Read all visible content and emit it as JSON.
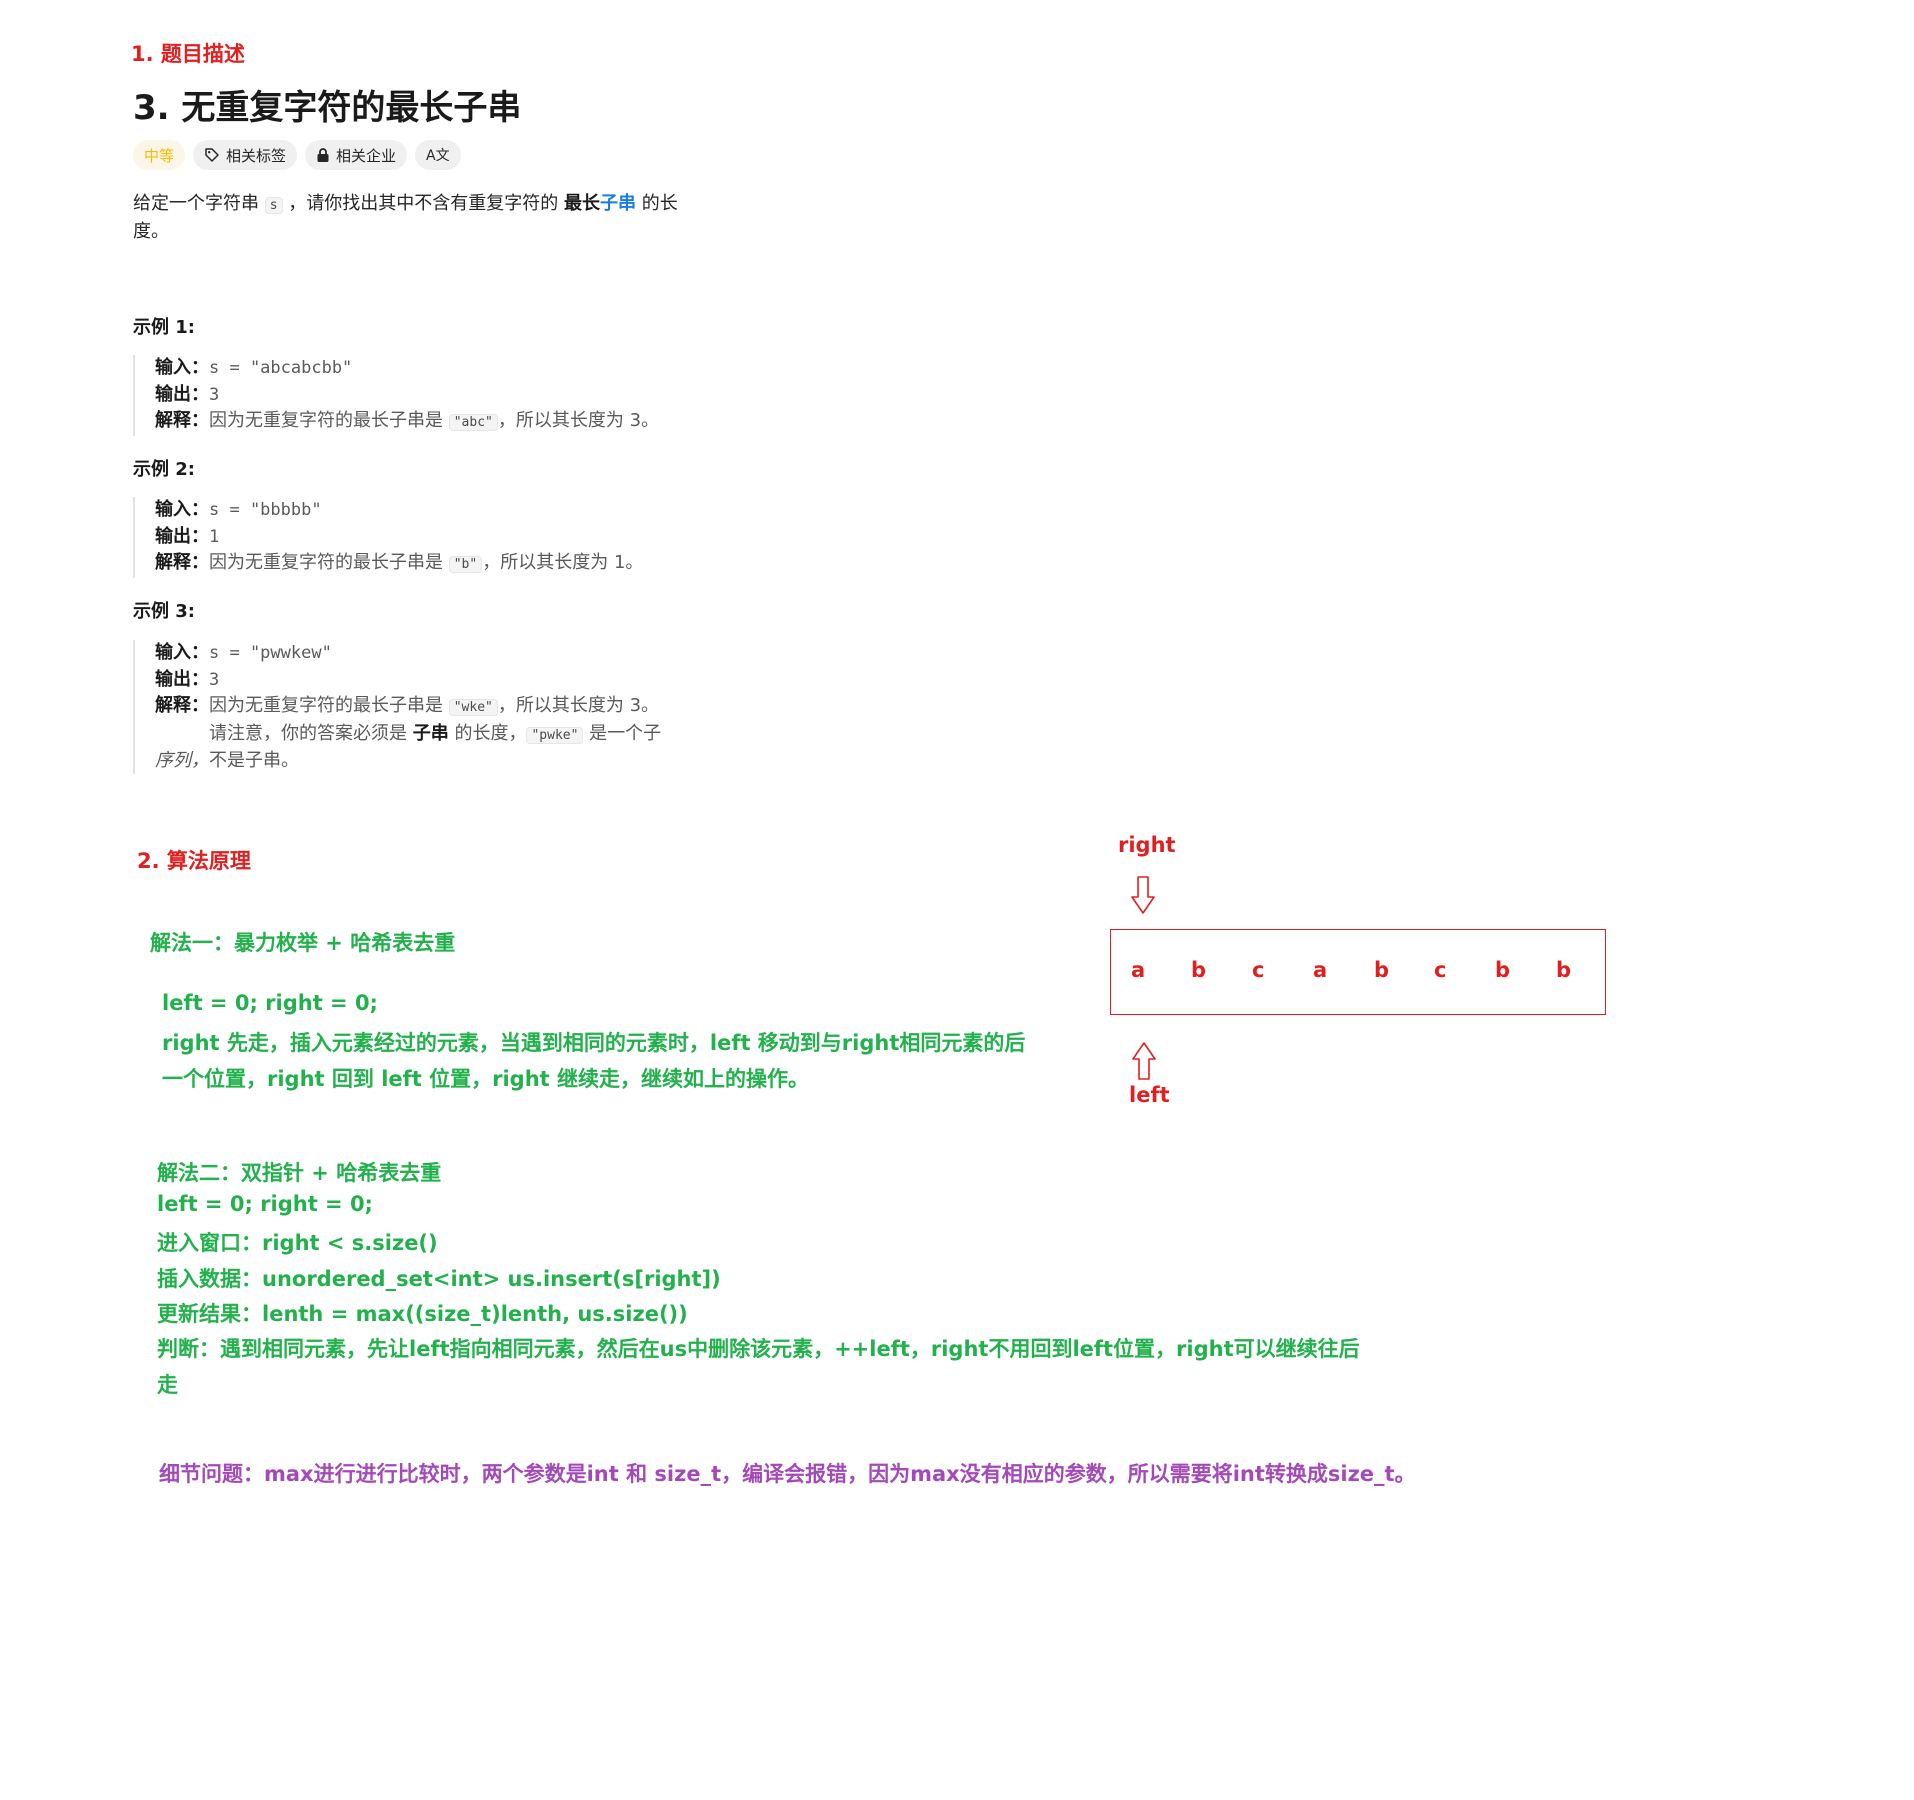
{
  "section1": {
    "title": "1. 题目描述"
  },
  "problem": {
    "title": "3. 无重复字符的最长子串",
    "tags": {
      "difficulty": "中等",
      "related_tags": "相关标签",
      "related_companies": "相关企业",
      "translate": "A文"
    },
    "description": {
      "part1": "给定一个字符串 ",
      "code": "s",
      "part2": " ，请你找出其中不含有重复字符的 ",
      "bold": "最长",
      "link": "子串",
      "part3": " 的长",
      "line2": "度。"
    }
  },
  "examples": [
    {
      "title": "示例 1:",
      "input_label": "输入：",
      "input_value": "s = \"abcabcbb\"",
      "output_label": "输出：",
      "output_value": "3",
      "explain_label": "解释：",
      "explain_text": "因为无重复字符的最长子串是 ",
      "explain_code": "\"abc\"",
      "explain_tail": "，所以其长度为 3。"
    },
    {
      "title": "示例 2:",
      "input_label": "输入：",
      "input_value": "s = \"bbbbb\"",
      "output_label": "输出：",
      "output_value": "1",
      "explain_label": "解释：",
      "explain_text": "因为无重复字符的最长子串是 ",
      "explain_code": "\"b\"",
      "explain_tail": "，所以其长度为 1。"
    },
    {
      "title": "示例 3:",
      "input_label": "输入：",
      "input_value": "s = \"pwwkew\"",
      "output_label": "输出：",
      "output_value": "3",
      "explain_label": "解释：",
      "explain_text": "因为无重复字符的最长子串是 ",
      "explain_code": "\"wke\"",
      "explain_tail": "，所以其长度为 3。",
      "note_part1": "请注意，你的答案必须是 ",
      "note_bold": "子串",
      "note_part2": " 的长度，",
      "note_code": "\"pwke\"",
      "note_part3": " 是一个子",
      "note_italic": "序列，",
      "note_part4": "不是子串。"
    }
  ],
  "section2": {
    "title": "2. 算法原理"
  },
  "method1": {
    "title": "解法一：暴力枚举 + 哈希表去重",
    "line1": "left = 0;  right = 0;",
    "line2": "right 先走，插入元素经过的元素，当遇到相同的元素时，left 移动到与right相同元素的后",
    "line3": "一个位置，right 回到 left 位置，right 继续走，继续如上的操作。"
  },
  "method2": {
    "title": "解法二：双指针  + 哈希表去重",
    "line1": "left = 0;   right = 0;",
    "line2": "进入窗口：right < s.size()",
    "line3": "插入数据：unordered_set<int> us.insert(s[right])",
    "line4": "更新结果：lenth = max((size_t)lenth, us.size())",
    "line5": "判断：遇到相同元素，先让left指向相同元素，然后在us中删除该元素，++left，right不用回到left位置，right可以继续往后",
    "line6": "走"
  },
  "detail": {
    "text": "细节问题：max进行进行比较时，两个参数是int 和 size_t，编译会报错，因为max没有相应的参数，所以需要将int转换成size_t。"
  },
  "diagram": {
    "right_label": "right",
    "left_label": "left",
    "chars": [
      "a",
      "b",
      "c",
      "a",
      "b",
      "c",
      "b",
      "b"
    ],
    "color": "#e02020"
  },
  "colors": {
    "section_red": "#e02020",
    "green": "#22b14c",
    "purple": "#a34ab8",
    "difficulty": "#ffb800",
    "link_blue": "#1a7de0"
  }
}
